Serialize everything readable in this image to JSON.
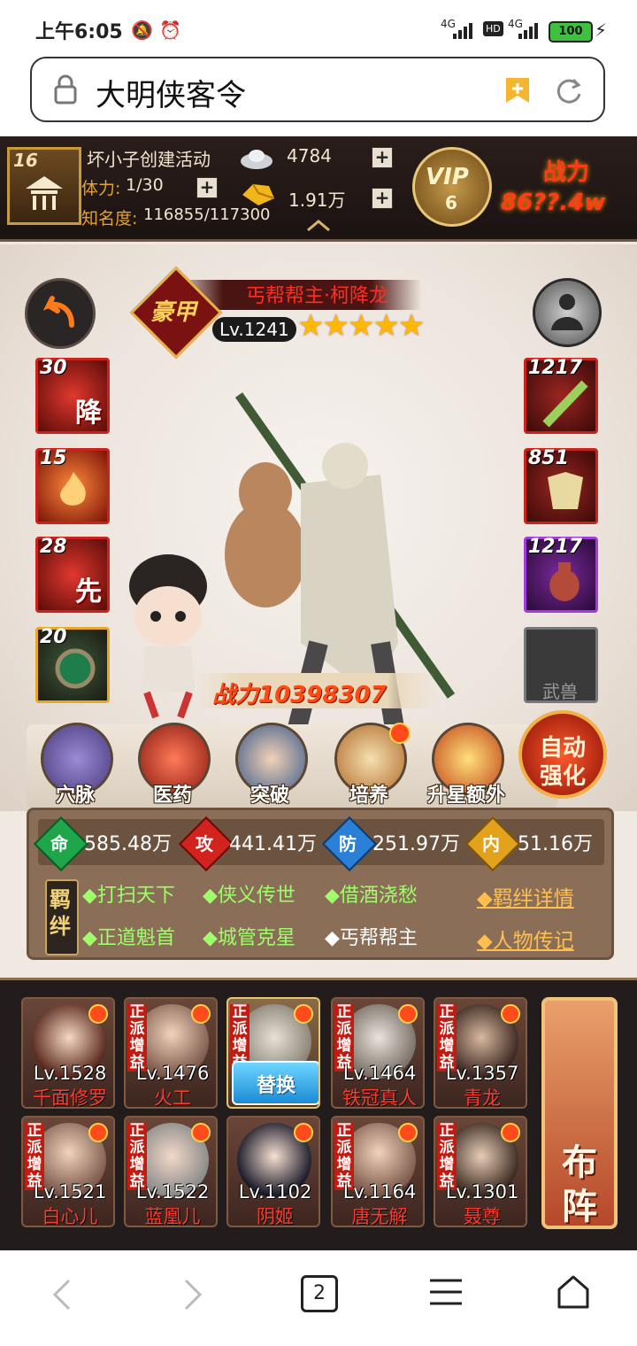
{
  "status_bar": {
    "time": "上午6:05",
    "battery": "100",
    "net1": "4G",
    "net2": "4G",
    "hd": "HD"
  },
  "url_bar": {
    "title": "大明侠客令"
  },
  "player": {
    "level": "16",
    "name": "坏小子创建活动",
    "stamina_label": "体力:",
    "stamina": "1/30",
    "fame_label": "知名度:",
    "fame": "116855/117300",
    "silver": "4784",
    "gold": "1.91万",
    "vip_label": "VIP",
    "vip_level": "6",
    "power_label": "战力",
    "power_value": "86??.4w"
  },
  "hero": {
    "title": "丐帮帮主·柯降龙",
    "grade": "豪甲",
    "level": "Lv.1241",
    "stars": "★★★★★",
    "power": "战力10398307"
  },
  "skills_left": [
    {
      "level": "30",
      "char": "降"
    },
    {
      "level": "15",
      "char": ""
    },
    {
      "level": "28",
      "char": "先"
    },
    {
      "level": "20",
      "char": ""
    }
  ],
  "equip_right": [
    {
      "level": "1217"
    },
    {
      "level": "851"
    },
    {
      "level": "1217"
    },
    {
      "level": "",
      "label": "武兽"
    }
  ],
  "menu": [
    {
      "label": "穴脉",
      "icon": "meridian-icon"
    },
    {
      "label": "医药",
      "icon": "medicine-icon"
    },
    {
      "label": "突破",
      "icon": "breakthrough-icon"
    },
    {
      "label": "培养",
      "icon": "cultivate-icon"
    },
    {
      "label": "升星额外",
      "icon": "star-up-icon"
    }
  ],
  "auto_strengthen": "自动\n强化",
  "auto_line1": "自动",
  "auto_line2": "强化",
  "attributes": [
    {
      "char": "命",
      "value": "585.48万",
      "color": "#1fa54a"
    },
    {
      "char": "攻",
      "value": "441.41万",
      "color": "#d3231f"
    },
    {
      "char": "防",
      "value": "251.97万",
      "color": "#2a7fd6"
    },
    {
      "char": "内",
      "value": "51.16万",
      "color": "#e3a21c"
    }
  ],
  "bonds_label": "羁绊",
  "bonds": [
    {
      "text": "◆打扫天下",
      "active": true
    },
    {
      "text": "◆侠义传世",
      "active": true
    },
    {
      "text": "◆借酒浇愁",
      "active": true
    },
    {
      "text": "◆正道魁首",
      "active": true
    },
    {
      "text": "◆城管克星",
      "active": true
    },
    {
      "text": "◆丐帮帮主",
      "active": false
    }
  ],
  "links": {
    "bond_detail": "◆羁绊详情",
    "biography": "◆人物传记"
  },
  "roster": [
    {
      "level": "Lv.1528",
      "name": "千面修罗",
      "tag": ""
    },
    {
      "level": "Lv.1476",
      "name": "火工",
      "tag": "正派增益"
    },
    {
      "level": "",
      "name": "",
      "tag": "正派增益",
      "replace": "替换"
    },
    {
      "level": "Lv.1464",
      "name": "铁冠真人",
      "tag": "正派增益"
    },
    {
      "level": "Lv.1357",
      "name": "青龙",
      "tag": "正派增益"
    },
    {
      "level": "Lv.1521",
      "name": "白心儿",
      "tag": "正派增益"
    },
    {
      "level": "Lv.1522",
      "name": "蓝凰儿",
      "tag": "正派增益"
    },
    {
      "level": "Lv.1102",
      "name": "阴姬",
      "tag": ""
    },
    {
      "level": "Lv.1164",
      "name": "唐无解",
      "tag": "正派增益"
    },
    {
      "level": "Lv.1301",
      "name": "聂尊",
      "tag": "正派增益"
    }
  ],
  "formation": {
    "line1": "布",
    "line2": "阵"
  },
  "bottom_nav": {
    "tabs_count": "2"
  }
}
